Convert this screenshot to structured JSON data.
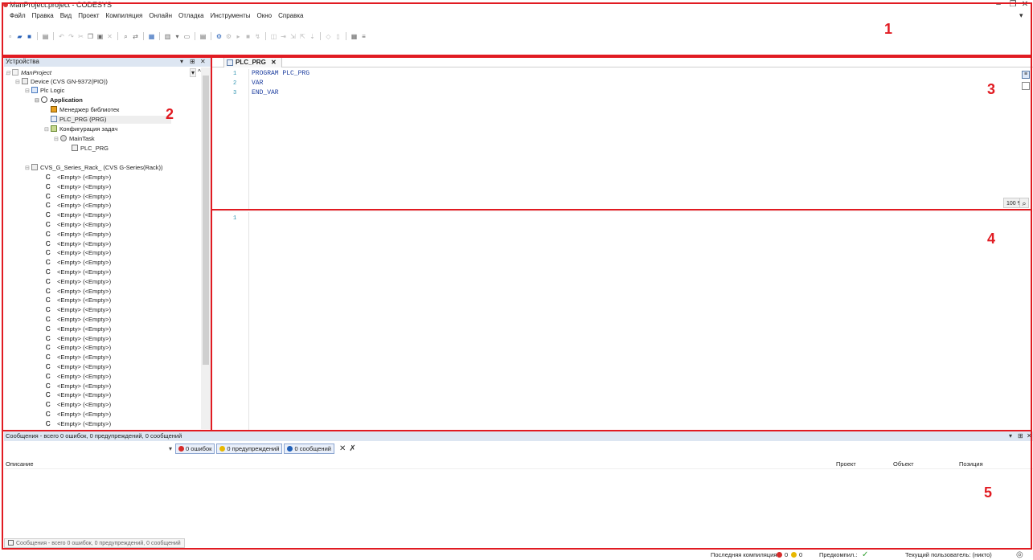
{
  "window": {
    "title": "ManProject.project - CODESYS",
    "controls": [
      "–",
      "❐",
      "✕"
    ]
  },
  "menu": [
    "Файл",
    "Правка",
    "Вид",
    "Проект",
    "Компиляция",
    "Онлайн",
    "Отладка",
    "Инструменты",
    "Окно",
    "Справка"
  ],
  "annotations": [
    "1",
    "2",
    "3",
    "4",
    "5"
  ],
  "devices": {
    "title": "Устройства",
    "controls": [
      "▾",
      "⊞",
      "✕"
    ],
    "tree": [
      {
        "label": "ManProject",
        "italic": true
      },
      {
        "label": "Device (CVS GN-9372(PIO))"
      },
      {
        "label": "Plc Logic"
      },
      {
        "label": "Application",
        "bold": true
      },
      {
        "label": "Менеджер библиотек"
      },
      {
        "label": "PLC_PRG (PRG)"
      },
      {
        "label": "Конфигурация задач"
      },
      {
        "label": "MainTask"
      },
      {
        "label": "PLC_PRG"
      },
      {
        "label": "CVS_G_Series_Rack_ (CVS G-Series(Rack))"
      }
    ],
    "empty_slot_label": "<Empty> (<Empty>)",
    "empty_slot_count": 27
  },
  "editor": {
    "tab_label": "PLC_PRG",
    "tab_close": "✕",
    "declaration": {
      "line_numbers": [
        "1",
        "2",
        "3"
      ],
      "lines": [
        "PROGRAM PLC_PRG",
        "VAR",
        "END_VAR"
      ]
    },
    "implementation": {
      "line_numbers": [
        "1"
      ]
    },
    "zoom": "100 %"
  },
  "messages": {
    "header": "Сообщения - всего 0 ошибок, 0 предупреждений, 0 сообщений",
    "controls": [
      "▾",
      "⊞",
      "✕"
    ],
    "filter": {
      "errors": "0 ошибок",
      "warnings": "0 предупреждений",
      "messages": "0 сообщений"
    },
    "columns": {
      "description": "Описание",
      "project": "Проект",
      "object": "Объект",
      "position": "Позиция"
    },
    "bottom_tab": "Сообщения - всего 0 ошибок, 0 предупреждений, 0 сообщений"
  },
  "status": {
    "last_compile_label": "Последняя компиляция:",
    "errors": "0",
    "warnings": "0",
    "precompile_label": "Предкомпил.:",
    "current_user": "Текущий пользователь: (никто)"
  },
  "colors": {
    "annotation": "#e11b22",
    "panel_header": "#dde6f2",
    "error": "#d62b2b",
    "warning": "#e8b800",
    "info": "#1f5fb8"
  }
}
